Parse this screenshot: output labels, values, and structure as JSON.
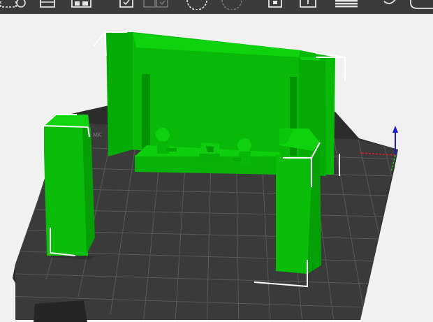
{
  "window": {
    "title": ""
  },
  "colors": {
    "toolbar": "#3b3b3b",
    "toolbar_icon": "#e6e6e6",
    "toolbar_icon_disabled": "#777777",
    "viewport_bg": "#f1f1f1",
    "bed": "#3a3a3a",
    "bed_edge": "#2c2c2c",
    "grid": "#5a5a5a",
    "model_light": "#0ecb0e",
    "model_mid": "#07b507",
    "model_dark": "#039903",
    "selection_box": "#ffffff",
    "axis_x": "#e02020",
    "axis_y": "#20c020",
    "axis_z": "#1a1ad0"
  },
  "toolbar": {
    "tools": [
      {
        "name": "select-by-rectangle",
        "icon": "rectangle-select-icon",
        "enabled": true
      },
      {
        "name": "add",
        "icon": "add-object-icon",
        "enabled": true
      },
      {
        "name": "arrange",
        "icon": "arrange-icon",
        "enabled": true
      },
      {
        "name": "copy",
        "icon": "copy-icon",
        "enabled": true
      },
      {
        "name": "paste",
        "icon": "paste-icon",
        "enabled": false
      },
      {
        "name": "undo-history",
        "icon": "undo-circle-icon",
        "enabled": true
      },
      {
        "name": "redo-history",
        "icon": "redo-circle-icon",
        "enabled": false
      },
      {
        "name": "split-to-objects",
        "icon": "split-objects-icon",
        "enabled": true
      },
      {
        "name": "split-to-parts",
        "icon": "split-parts-icon",
        "enabled": true
      },
      {
        "name": "layers-editing",
        "icon": "layers-icon",
        "enabled": true
      },
      {
        "name": "undo",
        "icon": "undo-arrow-icon",
        "enabled": true
      },
      {
        "name": "redo",
        "icon": "redo-arrow-icon",
        "enabled": true
      }
    ]
  },
  "viewport": {
    "objects": [
      {
        "name": "back-wall-panel"
      },
      {
        "name": "left-pillar"
      },
      {
        "name": "right-pillar"
      },
      {
        "name": "desk"
      },
      {
        "name": "figure-left"
      },
      {
        "name": "figure-right"
      },
      {
        "name": "center-box"
      }
    ]
  }
}
